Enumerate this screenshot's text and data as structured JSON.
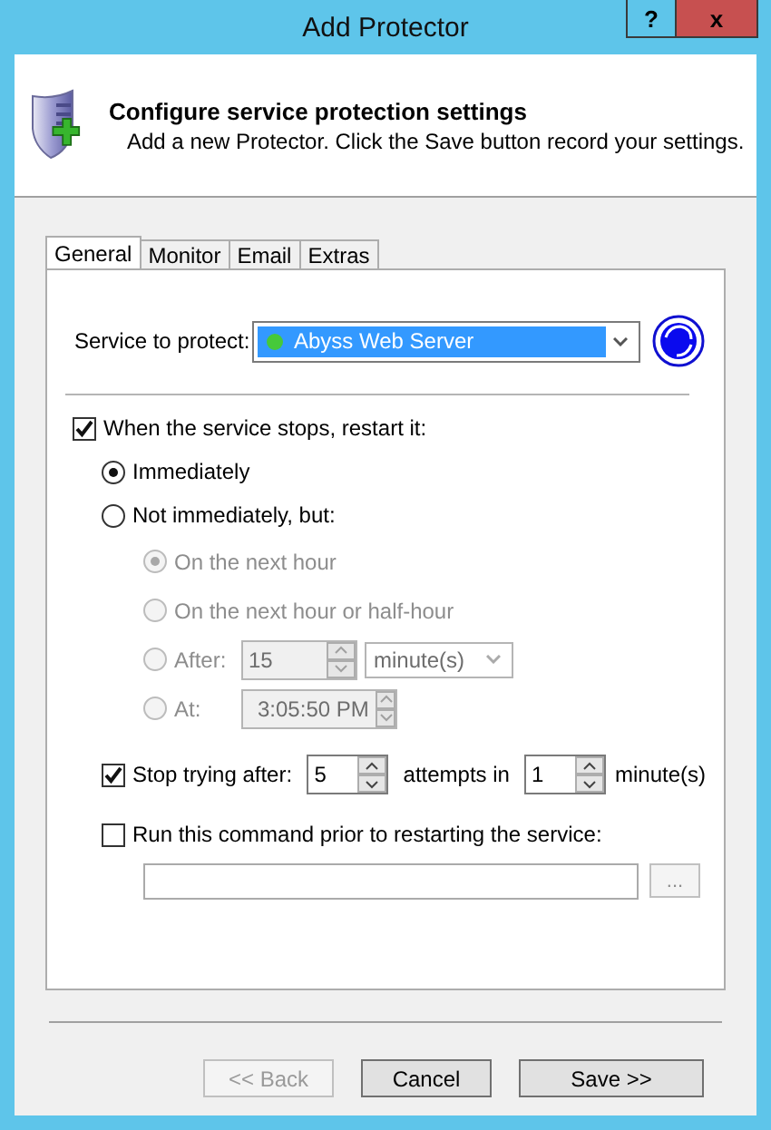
{
  "window": {
    "title": "Add Protector",
    "help_button": "?",
    "close_button": "x"
  },
  "header": {
    "title": "Configure service protection settings",
    "subtitle": "Add a new Protector. Click the Save button record your settings."
  },
  "tabs": [
    {
      "label": "General",
      "selected": true
    },
    {
      "label": "Monitor",
      "selected": false
    },
    {
      "label": "Email",
      "selected": false
    },
    {
      "label": "Extras",
      "selected": false
    }
  ],
  "service": {
    "label": "Service to protect:",
    "value": "Abyss Web Server",
    "running": true
  },
  "restart": {
    "label": "When the service stops, restart it:",
    "checked": true
  },
  "restart_modes": [
    {
      "label": "Immediately",
      "selected": true
    },
    {
      "label": "Not immediately, but:",
      "selected": false
    }
  ],
  "delay_options": [
    {
      "kind": "plain",
      "label": "On the next hour",
      "selected": true,
      "disabled": true
    },
    {
      "kind": "plain",
      "label": "On the next hour or half-hour",
      "selected": false,
      "disabled": true
    },
    {
      "kind": "after",
      "label": "After:",
      "selected": false,
      "disabled": true,
      "value": "15",
      "unit": "minute(s)"
    },
    {
      "kind": "at",
      "label": "At:",
      "selected": false,
      "disabled": true,
      "value": "3:05:50 PM"
    }
  ],
  "stop_trying": {
    "label": "Stop trying after:",
    "checked": true,
    "attempts": "5",
    "attempts_label": "attempts in",
    "minutes": "1",
    "minutes_label": "minute(s)"
  },
  "run_command": {
    "label": "Run this command prior to restarting the service:",
    "checked": false,
    "browse_button": "..."
  },
  "buttons": [
    {
      "label": "<< Back",
      "disabled": true
    },
    {
      "label": "Cancel",
      "disabled": false
    },
    {
      "label": "Save >>",
      "disabled": false
    }
  ]
}
